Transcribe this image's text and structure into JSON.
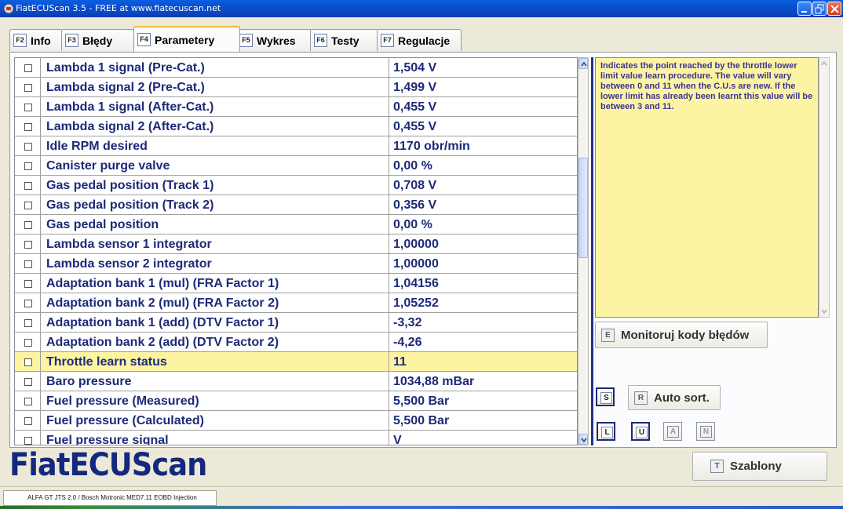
{
  "window": {
    "title": "FiatECUScan 3.5 - FREE at www.fiatecuscan.net"
  },
  "tabs": [
    {
      "key": "F2",
      "label": "Info"
    },
    {
      "key": "F3",
      "label": "Błędy"
    },
    {
      "key": "F4",
      "label": "Parametery",
      "active": true
    },
    {
      "key": "F5",
      "label": "Wykres"
    },
    {
      "key": "F6",
      "label": "Testy"
    },
    {
      "key": "F7",
      "label": "Regulacje"
    }
  ],
  "params": [
    {
      "name": "Lambda 1 signal (Pre-Cat.)",
      "value": "1,504 V"
    },
    {
      "name": "Lambda signal 2 (Pre-Cat.)",
      "value": "1,499 V"
    },
    {
      "name": "Lambda 1 signal (After-Cat.)",
      "value": "0,455 V"
    },
    {
      "name": "Lambda signal 2 (After-Cat.)",
      "value": "0,455 V"
    },
    {
      "name": "Idle RPM desired",
      "value": "1170 obr/min"
    },
    {
      "name": "Canister purge valve",
      "value": "0,00 %"
    },
    {
      "name": "Gas pedal position (Track 1)",
      "value": "0,708 V"
    },
    {
      "name": "Gas pedal position (Track 2)",
      "value": "0,356 V"
    },
    {
      "name": "Gas pedal position",
      "value": "0,00 %"
    },
    {
      "name": "Lambda sensor 1 integrator",
      "value": "1,00000"
    },
    {
      "name": "Lambda sensor 2 integrator",
      "value": "1,00000"
    },
    {
      "name": "Adaptation bank 1 (mul) (FRA Factor 1)",
      "value": "1,04156"
    },
    {
      "name": "Adaptation bank 2 (mul) (FRA Factor 2)",
      "value": "1,05252"
    },
    {
      "name": "Adaptation bank 1 (add) (DTV Factor 1)",
      "value": "-3,32"
    },
    {
      "name": "Adaptation bank 2 (add) (DTV Factor 2)",
      "value": "-4,26"
    },
    {
      "name": "Throttle learn status",
      "value": "11",
      "selected": true
    },
    {
      "name": "Baro pressure",
      "value": "1034,88 mBar"
    },
    {
      "name": "Fuel pressure (Measured)",
      "value": "5,500 Bar"
    },
    {
      "name": "Fuel pressure (Calculated)",
      "value": "5,500 Bar"
    },
    {
      "name": "Fuel pressure signal",
      "value": "V"
    }
  ],
  "help": {
    "text": "Indicates the point reached by the throttle lower limit value learn procedure. The value will vary between 0 and 11  when the C.U.s are new. If the lower limit has already been learnt this value will be between 3 and 11."
  },
  "buttons": {
    "monitor_key": "E",
    "monitor_label": "Monitoruj kody błędów",
    "s_key": "S",
    "autosort_key": "R",
    "autosort_label": "Auto sort.",
    "l_key": "L",
    "u_key": "U",
    "a_key": "A",
    "n_key": "N",
    "templates_key": "T",
    "templates_label": "Szablony"
  },
  "logo": "FiatECUScan",
  "status": {
    "ecu": "ALFA GT JTS 2.0 / Bosch Motronic MED7.11 EOBD Injection"
  },
  "colors": {
    "accent": "#1d2a78",
    "highlight": "#fcf4a2",
    "titlebar": "#0a4ed0"
  }
}
